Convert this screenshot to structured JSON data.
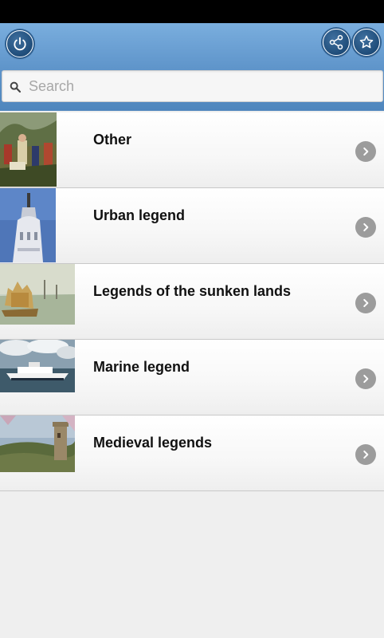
{
  "toolbar": {
    "power_icon": "power-icon",
    "share_icon": "share-icon",
    "star_icon": "star-icon"
  },
  "search": {
    "placeholder": "Search"
  },
  "items": [
    {
      "label": "Other",
      "thumb": "painting-crowd"
    },
    {
      "label": "Urban legend",
      "thumb": "tower"
    },
    {
      "label": "Legends of the sunken lands",
      "thumb": "golden-city"
    },
    {
      "label": "Marine legend",
      "thumb": "ferry-ship"
    },
    {
      "label": "Medieval legends",
      "thumb": "castle-landscape"
    }
  ],
  "colors": {
    "action_bar": "#5d93c9",
    "status_bar": "#000000",
    "chevron": "#9c9c9c"
  }
}
